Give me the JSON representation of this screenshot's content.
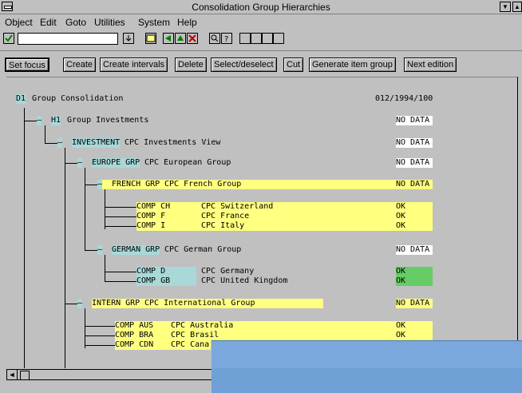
{
  "window": {
    "title": "Consolidation Group Hierarchies"
  },
  "menu": [
    "Object",
    "Edit",
    "Goto",
    "Utilities",
    "System",
    "Help"
  ],
  "toolbar_buttons": [
    "check-icon",
    "save-icon",
    "back-icon",
    "exit-icon",
    "cancel-icon",
    "find-icon",
    "help-icon",
    "first-page-icon",
    "prev-page-icon",
    "next-page-icon",
    "last-page-icon"
  ],
  "app_buttons": [
    "Set focus",
    "Create",
    "Create intervals",
    "Delete",
    "Select/deselect",
    "Cut",
    "Generate item group",
    "Next edition"
  ],
  "root": {
    "code": "D1",
    "name": "Group Consolidation",
    "value": "012/1994/100"
  },
  "h1": {
    "minus": "–",
    "code": "H1",
    "name": "Group Investments",
    "status": "NO DATA"
  },
  "investment": {
    "minus": "–",
    "code": "INVESTMENT",
    "name": "CPC Investments View",
    "status": "NO DATA"
  },
  "europe": {
    "minus": "–",
    "code": "EUROPE GRP",
    "name": "CPC European Group",
    "status": "NO DATA"
  },
  "french": {
    "minus": "–",
    "code": "FRENCH GRP",
    "name": "CPC French Group",
    "status": "NO DATA"
  },
  "french_comps": [
    {
      "code": "COMP CH",
      "name": "CPC Switzerland",
      "status": "OK"
    },
    {
      "code": "COMP F",
      "name": "CPC France",
      "status": "OK"
    },
    {
      "code": "COMP I",
      "name": "CPC Italy",
      "status": "OK"
    }
  ],
  "german": {
    "minus": "–",
    "code": "GERMAN GRP",
    "name": "CPC German Group",
    "status": "NO DATA"
  },
  "german_comps": [
    {
      "code": "COMP D",
      "name": "CPC Germany",
      "status": "OK"
    },
    {
      "code": "COMP GB",
      "name": "CPC United Kingdom",
      "status": "OK"
    }
  ],
  "intern": {
    "minus": "–",
    "code": "INTERN GRP",
    "name": "CPC International Group",
    "status": "NO DATA"
  },
  "intern_comps": [
    {
      "code": "COMP AUS",
      "name": "CPC Australia",
      "status": "OK"
    },
    {
      "code": "COMP BRA",
      "name": "CPC Brasil",
      "status": "OK"
    },
    {
      "code": "COMP CDN",
      "name": "CPC Cana",
      "status": ""
    }
  ]
}
